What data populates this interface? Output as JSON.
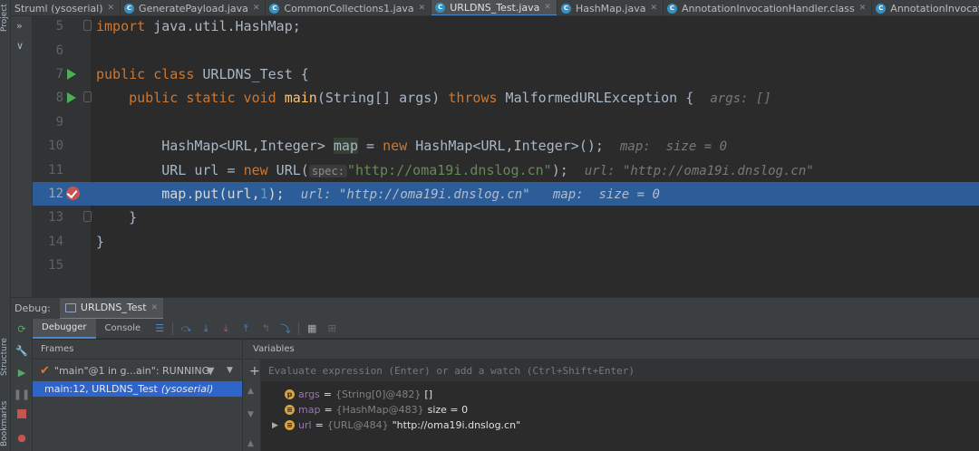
{
  "left_strip": {
    "project_label": "Project",
    "structure_label": "Structure",
    "bookmarks_label": "Bookmarks"
  },
  "tabs": [
    {
      "label": "Stru",
      "extra": "ml (ysoserial)",
      "icon": "",
      "active": false
    },
    {
      "label": "GeneratePayload.java",
      "icon": "C",
      "active": false
    },
    {
      "label": "CommonCollections1.java",
      "icon": "C",
      "active": false
    },
    {
      "label": "URLDNS_Test.java",
      "icon": "C",
      "active": true
    },
    {
      "label": "HashMap.java",
      "icon": "C",
      "active": false
    },
    {
      "label": "AnnotationInvocationHandler.class",
      "icon": "C",
      "active": false
    },
    {
      "label": "AnnotationInvocationHandler.j",
      "icon": "C",
      "active": false
    }
  ],
  "tree": {
    "chevron1": "»",
    "chevron2": "∨"
  },
  "editor": {
    "lines": [
      {
        "num": "5"
      },
      {
        "num": "6"
      },
      {
        "num": "7"
      },
      {
        "num": "8"
      },
      {
        "num": "9"
      },
      {
        "num": "10"
      },
      {
        "num": "11"
      },
      {
        "num": "12"
      },
      {
        "num": "13"
      },
      {
        "num": "14"
      },
      {
        "num": "15"
      }
    ],
    "code": {
      "l5_kw": "import",
      "l5_rest": " java.util.HashMap;",
      "l7_kw": "public class",
      "l7_rest": " URLDNS_Test {",
      "l8_kw1": "public static void",
      "l8_fn": "main",
      "l8_mid": "(String[] args) ",
      "l8_kw2": "throws",
      "l8_rest": " MalformedURLException {",
      "l8_hint": "args: []",
      "l10_a": "HashMap<URL,Integer> ",
      "l10_var": "map",
      "l10_b": " = ",
      "l10_kw": "new",
      "l10_c": " HashMap<URL,Integer>();",
      "l10_hint": "map:  size = 0",
      "l11_a": "URL url = ",
      "l11_kw": "new",
      "l11_b": " URL(",
      "l11_inlay": "spec:",
      "l11_str": "\"http://oma19i.dnslog.cn\"",
      "l11_c": ");",
      "l11_hint": "url: \"http://oma19i.dnslog.cn\"",
      "l12_a": "map.put(url,",
      "l12_num": "1",
      "l12_b": ");",
      "l12_hint": "url: \"http://oma19i.dnslog.cn\"   map:  size = 0",
      "l13": "}",
      "l14": "}"
    }
  },
  "debug": {
    "label": "Debug:",
    "session_tab": "URLDNS_Test",
    "toolbar_tabs": {
      "debugger": "Debugger",
      "console": "Console"
    },
    "frames_title": "Frames",
    "thread": "\"main\"@1 in g...ain\": RUNNING",
    "frame": "main:12, URLDNS_Test",
    "frame_module": "(ysoserial)",
    "variables_title": "Variables",
    "eval_placeholder": "Evaluate expression (Enter) or add a watch (Ctrl+Shift+Enter)",
    "variables": [
      {
        "icon": "p",
        "name": "args",
        "type": "{String[0]@482}",
        "value": "[]"
      },
      {
        "icon": "≡",
        "name": "map",
        "type": "{HashMap@483}",
        "value": "size = 0"
      },
      {
        "icon": "≡",
        "name": "url",
        "type": "{URL@484}",
        "value": "\"http://oma19i.dnslog.cn\""
      }
    ]
  },
  "colors": {
    "accent": "#4a88c7",
    "current_line": "#2d5d99",
    "keyword": "#cc7832",
    "string": "#6a8759",
    "breakpoint": "#c75450",
    "selection": "#2f65ca"
  }
}
